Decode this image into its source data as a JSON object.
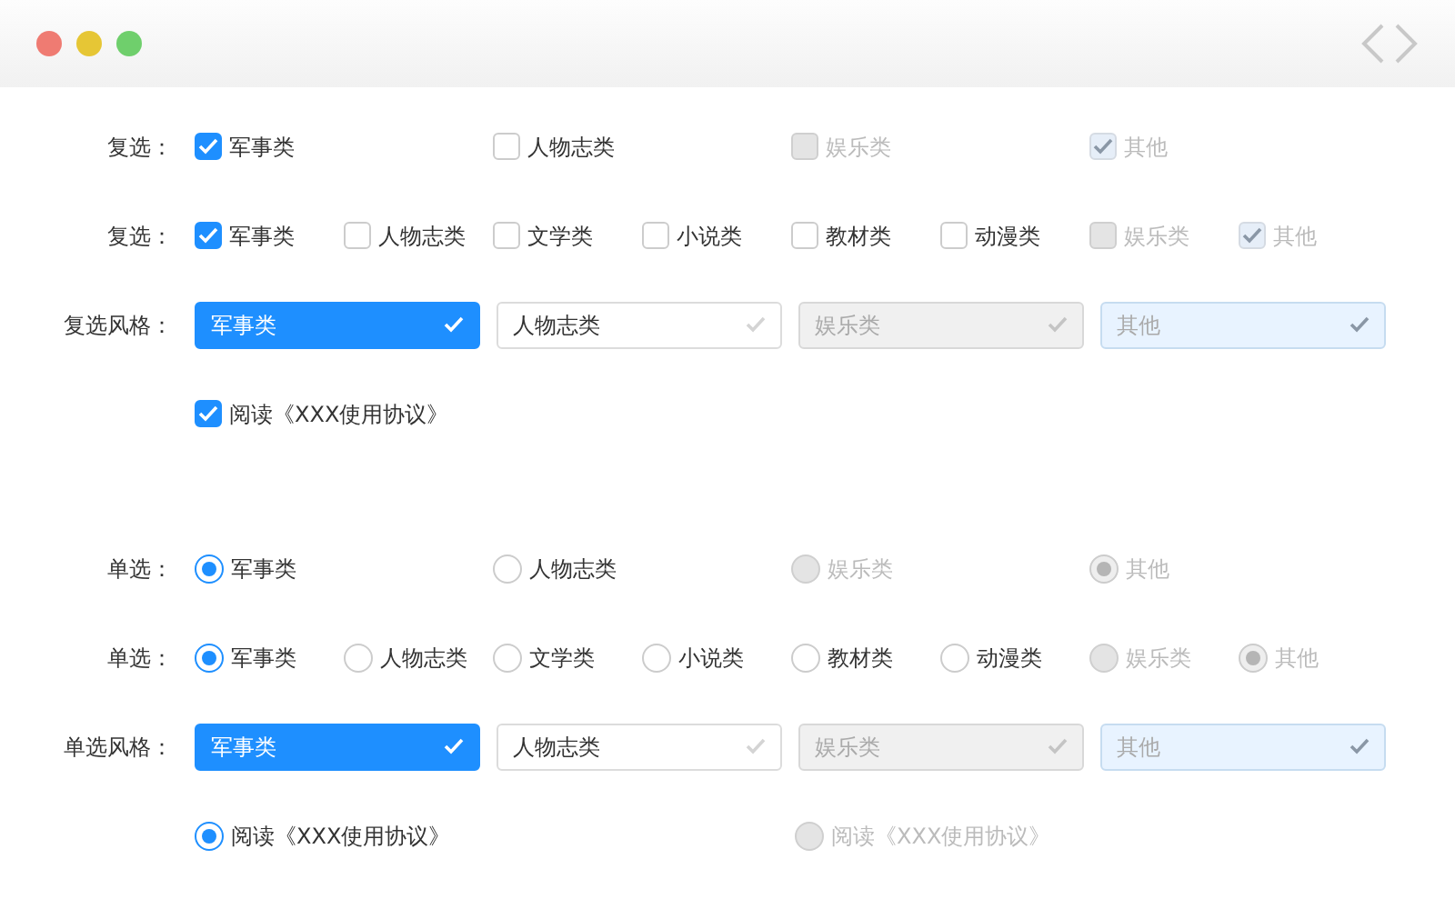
{
  "window": {
    "buttons": [
      {
        "color": "#ef7b72"
      },
      {
        "color": "#e6c635"
      },
      {
        "color": "#6fcf6c"
      }
    ]
  },
  "rows": [
    {
      "kind": "checks",
      "label": "复选：",
      "options": [
        {
          "label": "军事类",
          "checked": true,
          "disabled": false
        },
        {
          "label": "人物志类",
          "checked": false,
          "disabled": false
        },
        {
          "label": "娱乐类",
          "checked": false,
          "disabled": true
        },
        {
          "label": "其他",
          "checked": true,
          "disabled": true
        }
      ]
    },
    {
      "kind": "checks",
      "label": "复选：",
      "options": [
        {
          "label": "军事类",
          "checked": true,
          "disabled": false
        },
        {
          "label": "人物志类",
          "checked": false,
          "disabled": false
        },
        {
          "label": "文学类",
          "checked": false,
          "disabled": false
        },
        {
          "label": "小说类",
          "checked": false,
          "disabled": false
        },
        {
          "label": "教材类",
          "checked": false,
          "disabled": false
        },
        {
          "label": "动漫类",
          "checked": false,
          "disabled": false
        },
        {
          "label": "娱乐类",
          "checked": false,
          "disabled": true
        },
        {
          "label": "其他",
          "checked": true,
          "disabled": true
        }
      ]
    },
    {
      "kind": "check_tiles",
      "label": "复选风格：",
      "options": [
        {
          "label": "军事类",
          "checked": true,
          "disabled": false
        },
        {
          "label": "人物志类",
          "checked": false,
          "disabled": false
        },
        {
          "label": "娱乐类",
          "checked": false,
          "disabled": true
        },
        {
          "label": "其他",
          "checked": true,
          "disabled": true
        }
      ]
    },
    {
      "kind": "check_agree",
      "options": [
        {
          "label": "阅读《XXX使用协议》",
          "checked": true,
          "disabled": false
        }
      ]
    },
    {
      "kind": "radios",
      "label": "单选：",
      "options": [
        {
          "label": "军事类",
          "checked": true,
          "disabled": false
        },
        {
          "label": "人物志类",
          "checked": false,
          "disabled": false
        },
        {
          "label": "娱乐类",
          "checked": false,
          "disabled": true
        },
        {
          "label": "其他",
          "checked": true,
          "disabled": true
        }
      ]
    },
    {
      "kind": "radios",
      "label": "单选：",
      "options": [
        {
          "label": "军事类",
          "checked": true,
          "disabled": false
        },
        {
          "label": "人物志类",
          "checked": false,
          "disabled": false
        },
        {
          "label": "文学类",
          "checked": false,
          "disabled": false
        },
        {
          "label": "小说类",
          "checked": false,
          "disabled": false
        },
        {
          "label": "教材类",
          "checked": false,
          "disabled": false
        },
        {
          "label": "动漫类",
          "checked": false,
          "disabled": false
        },
        {
          "label": "娱乐类",
          "checked": false,
          "disabled": true
        },
        {
          "label": "其他",
          "checked": true,
          "disabled": true
        }
      ]
    },
    {
      "kind": "radio_tiles",
      "label": "单选风格：",
      "options": [
        {
          "label": "军事类",
          "checked": true,
          "disabled": false
        },
        {
          "label": "人物志类",
          "checked": false,
          "disabled": false
        },
        {
          "label": "娱乐类",
          "checked": false,
          "disabled": true
        },
        {
          "label": "其他",
          "checked": true,
          "disabled": true
        }
      ]
    },
    {
      "kind": "radio_agree",
      "options": [
        {
          "label": "阅读《XXX使用协议》",
          "checked": true,
          "disabled": false
        },
        {
          "label": "阅读《XXX使用协议》",
          "checked": false,
          "disabled": true
        }
      ]
    }
  ]
}
